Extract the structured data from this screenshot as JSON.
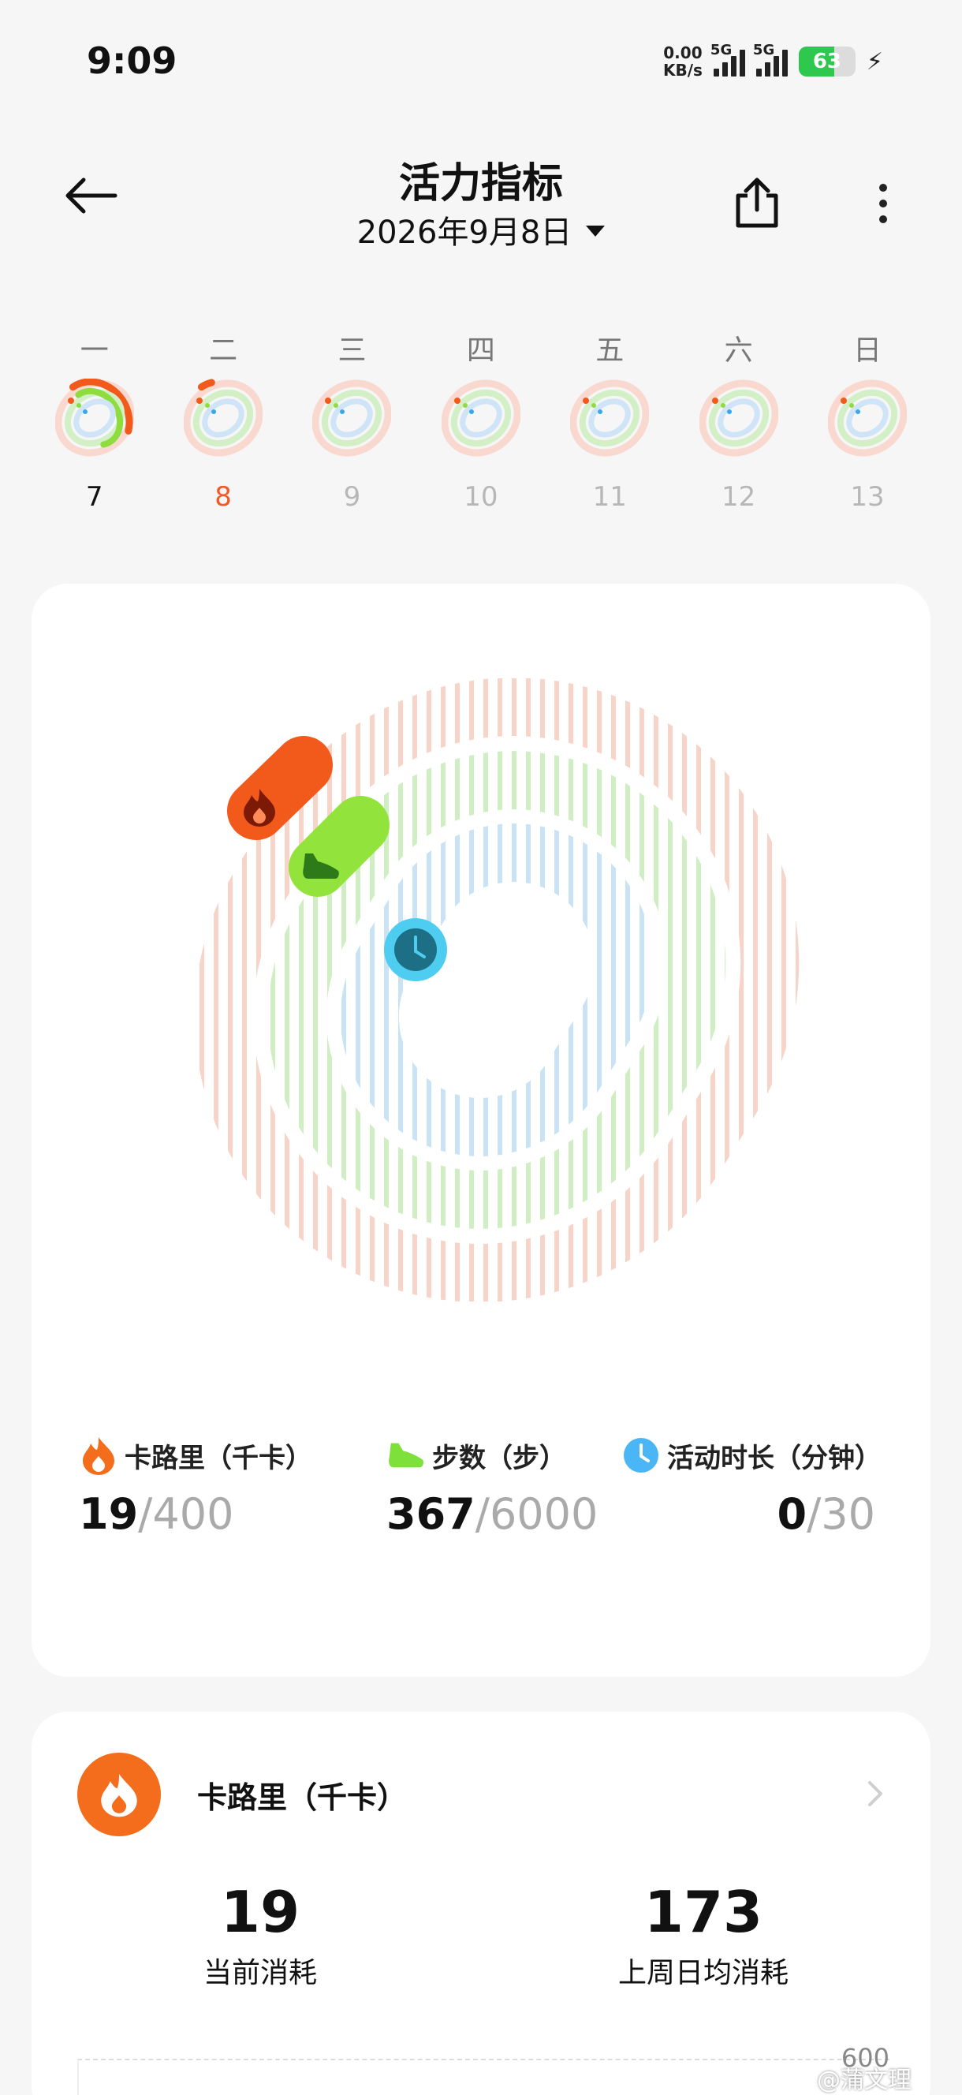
{
  "status_bar": {
    "time": "9:09",
    "net_speed_value": "0.00",
    "net_speed_unit": "KB/s",
    "sim1_label": "5G",
    "sim2_label": "5G",
    "battery_level": "63",
    "battery_percent": 63,
    "charging_icon": "bolt-icon"
  },
  "header": {
    "back_icon": "arrow-left-icon",
    "title": "活力指标",
    "date": "2026年9月8日",
    "share_icon": "share-icon",
    "more_icon": "more-vertical-icon"
  },
  "week": {
    "days": [
      {
        "label": "一",
        "date": "7",
        "state": "past",
        "calorie_progress": 0.4
      },
      {
        "label": "二",
        "date": "8",
        "state": "today",
        "calorie_progress": 0.05
      },
      {
        "label": "三",
        "date": "9",
        "state": "future",
        "calorie_progress": 0
      },
      {
        "label": "四",
        "date": "10",
        "state": "future",
        "calorie_progress": 0
      },
      {
        "label": "五",
        "date": "11",
        "state": "future",
        "calorie_progress": 0
      },
      {
        "label": "六",
        "date": "12",
        "state": "future",
        "calorie_progress": 0
      },
      {
        "label": "日",
        "date": "13",
        "state": "future",
        "calorie_progress": 0
      }
    ]
  },
  "rings": {
    "calories": {
      "icon": "flame-icon",
      "color": "#f25a1c",
      "track_color": "#f8d3c7",
      "progress": 0.0475
    },
    "steps": {
      "icon": "shoe-icon",
      "color": "#93e33d",
      "track_color": "#cfeec2",
      "progress": 0.061
    },
    "duration": {
      "icon": "clock-icon",
      "color": "#4fcdf0",
      "track_color": "#c9e3f6",
      "progress": 0
    }
  },
  "metrics": {
    "calories": {
      "label": "卡路里（千卡）",
      "current": "19",
      "separator": "/",
      "goal": "400",
      "icon": "flame-icon"
    },
    "steps": {
      "label": "步数（步）",
      "current": "367",
      "separator": "/",
      "goal": "6000",
      "icon": "shoe-icon"
    },
    "duration": {
      "label": "活动时长（分钟）",
      "current": "0",
      "separator": "/",
      "goal": "30",
      "icon": "clock-icon"
    }
  },
  "calorie_card": {
    "icon": "flame-icon",
    "title": "卡路里（千卡）",
    "chevron_icon": "chevron-right-icon",
    "current_value": "19",
    "current_label": "当前消耗",
    "avg_value": "173",
    "avg_label": "上周日均消耗",
    "chart_max": "600"
  },
  "watermark": "@蒲文理"
}
